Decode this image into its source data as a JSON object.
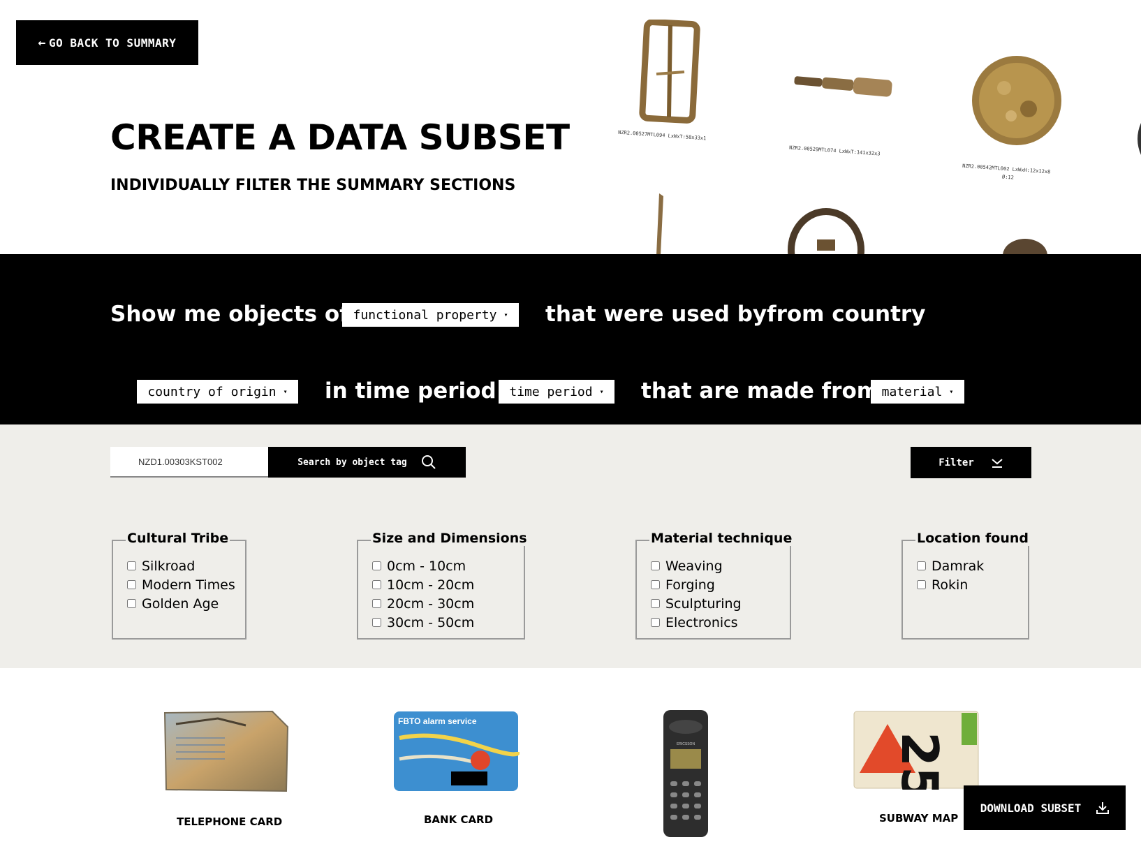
{
  "nav": {
    "back_label": "GO BACK TO SUMMARY"
  },
  "header": {
    "title": "CREATE A DATA SUBSET",
    "subtitle": "INDIVIDUALLY FILTER THE SUMMARY SECTIONS"
  },
  "artifacts": [
    {
      "caption": "NZR2.00527MTL094 LxWxT:58x33x1",
      "icon": "buckle-icon"
    },
    {
      "caption": "NZR2.00529MTL074 LxWxT:141x32x3",
      "icon": "cylinder-object-icon"
    },
    {
      "caption": "NZR2.00542MTL002 LxWxH:12x12x8",
      "caption2": "Ø:12",
      "icon": "button-object-icon"
    }
  ],
  "sentence": {
    "p1": "Show me objects of",
    "select1": "functional property",
    "p2": "that were used byfrom country",
    "select2": "country of origin",
    "p3": "in time period",
    "select3": "time period",
    "p4": "that are made from",
    "select4": "material"
  },
  "search": {
    "value": "NZD1.00303KST002",
    "button_label": "Search by object tag"
  },
  "filter": {
    "button_label": "Filter"
  },
  "filter_groups": [
    {
      "title": "Cultural Tribe",
      "options": [
        "Silkroad",
        "Modern Times",
        "Golden Age"
      ]
    },
    {
      "title": "Size and Dimensions",
      "options": [
        "0cm - 10cm",
        "10cm - 20cm",
        "20cm - 30cm",
        "30cm - 50cm"
      ]
    },
    {
      "title": "Material technique",
      "options": [
        "Weaving",
        "Forging",
        "Sculpturing",
        "Electronics"
      ]
    },
    {
      "title": "Location found",
      "options": [
        "Damrak",
        "Rokin"
      ]
    }
  ],
  "results": [
    {
      "label": "TELEPHONE CARD"
    },
    {
      "label": "BANK CARD",
      "card_text": "FBTO alarm service"
    },
    {
      "label": "",
      "brand": "ERICSSON"
    },
    {
      "label": "SUBWAY MAP",
      "number": "25"
    }
  ],
  "download": {
    "label": "DOWNLOAD SUBSET"
  },
  "colors": {
    "band": "#000000",
    "filter_bg": "#efeeea",
    "accent_text": "#ffffff"
  }
}
